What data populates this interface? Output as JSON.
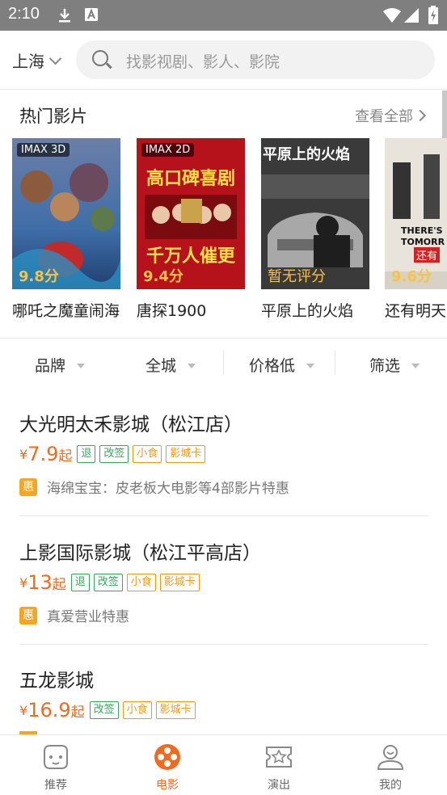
{
  "status_bar": {
    "time": "2:10"
  },
  "header": {
    "city": "上海",
    "search_placeholder": "找影视剧、影人、影院"
  },
  "hot_movies": {
    "title": "热门影片",
    "see_all": "查看全部",
    "items": [
      {
        "name": "哪吒之魔童闹海",
        "badge": "IMAX 3D",
        "score": "9.8分",
        "poster_color": "#4a6fa8"
      },
      {
        "name": "唐探1900",
        "badge": "IMAX 2D",
        "score": "9.4分",
        "poster_color": "#c0141a",
        "poster_text_top": "高口碑喜剧",
        "poster_text_bottom": "千万人催更"
      },
      {
        "name": "平原上的火焰",
        "badge": "",
        "score": "暂无评分",
        "poster_color": "#2e2e2e",
        "poster_text_top": "平原上的火焰"
      },
      {
        "name": "还有明天",
        "badge": "",
        "score": "9.6分",
        "poster_color": "#e8e4dc",
        "poster_text_top": "THERE'S TOMORR",
        "poster_text_bottom": "还有"
      }
    ]
  },
  "filters": [
    {
      "label": "品牌"
    },
    {
      "label": "全城"
    },
    {
      "label": "价格低"
    },
    {
      "label": "筛选"
    }
  ],
  "cinemas": [
    {
      "name": "大光明太禾影城（松江店）",
      "price_yen": "¥",
      "price": "7.9",
      "price_suffix": "起",
      "tags": [
        "退",
        "改签",
        "小食",
        "影城卡"
      ],
      "promo_badge": "惠",
      "promo": "海绵宝宝：皮老板大电影等4部影片特惠"
    },
    {
      "name": "上影国际影城（松江平高店）",
      "price_yen": "¥",
      "price": "13",
      "price_suffix": "起",
      "tags": [
        "退",
        "改签",
        "小食",
        "影城卡"
      ],
      "promo_badge": "惠",
      "promo": "真爱营业特惠"
    },
    {
      "name": "五龙影城",
      "price_yen": "¥",
      "price": "16.9",
      "price_suffix": "起",
      "tags": [
        "改签",
        "小食",
        "影城卡"
      ]
    }
  ],
  "tabbar": [
    {
      "label": "推荐",
      "icon": "gamepad-icon",
      "active": false
    },
    {
      "label": "电影",
      "icon": "film-reel-icon",
      "active": true
    },
    {
      "label": "演出",
      "icon": "ticket-star-icon",
      "active": false
    },
    {
      "label": "我的",
      "icon": "user-icon",
      "active": false
    }
  ],
  "colors": {
    "accent": "#f06a1f",
    "tag_green": "#3aa55c",
    "tag_orange": "#f39a14",
    "promo_badge": "#f5a623"
  }
}
